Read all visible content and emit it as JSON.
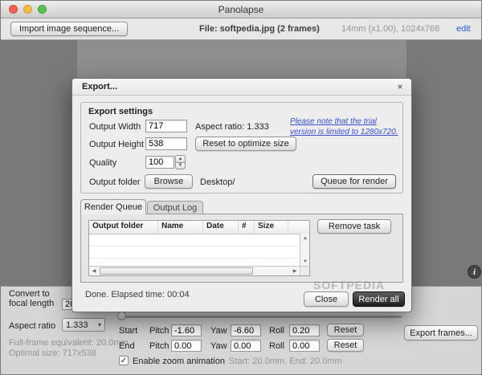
{
  "window": {
    "title": "Panolapse"
  },
  "toolbar": {
    "import_button": "Import image sequence...",
    "file_label": "File: softpedia.jpg (2 frames)",
    "lens_info": "14mm (x1.00), 1024x768",
    "edit_link": "edit"
  },
  "export_dialog": {
    "title": "Export...",
    "settings": {
      "group_title": "Export settings",
      "output_width_label": "Output Width",
      "output_width": "717",
      "aspect_ratio_text": "Aspect ratio: 1.333",
      "trial_note": "Please note that the trial version is limited to 1280x720.",
      "output_height_label": "Output Height",
      "output_height": "538",
      "reset_optimize_button": "Reset to optimize size",
      "quality_label": "Quality",
      "quality": "100",
      "output_folder_label": "Output folder",
      "browse_button": "Browse",
      "output_folder_path": "Desktop/",
      "queue_button": "Queue for render"
    },
    "tabs": [
      {
        "label": "Render Queue",
        "active": true
      },
      {
        "label": "Output Log",
        "active": false
      }
    ],
    "queue_table": {
      "columns": [
        "Output folder",
        "Name",
        "Date",
        "#",
        "Size"
      ],
      "rows": []
    },
    "remove_task_button": "Remove task",
    "status_text": "Done. Elapsed time: 00:04",
    "close_button": "Close",
    "render_all_button": "Render all"
  },
  "bottom_panel": {
    "convert_label": "Convert to focal length",
    "convert_value": "20",
    "aspect_ratio_label": "Aspect ratio",
    "aspect_ratio_value": "1.333",
    "full_frame_text": "Full-frame equivalent: 20.0mm",
    "optimal_size_text": "Optimal size: 717x538",
    "start_label": "Start",
    "end_label": "End",
    "pitch_label": "Pitch",
    "yaw_label": "Yaw",
    "roll_label": "Roll",
    "start": {
      "pitch": "-1.60",
      "yaw": "-6.60",
      "roll": "0.20"
    },
    "end": {
      "pitch": "0.00",
      "yaw": "0.00",
      "roll": "0.00"
    },
    "reset_button": "Reset",
    "zoom_checkbox_label": "Enable zoom animation",
    "zoom_checkbox_checked": true,
    "zoom_range_text": "Start: 20.0mm, End: 20.0mm",
    "export_frames_button": "Export frames..."
  },
  "watermark": "SOFTPEDIA",
  "colors": {
    "link_blue": "#2a5bd7",
    "trial_note_blue": "#3c4ed8",
    "render_all_dark": "#1e1e1e",
    "canvas_gray": "#8d8d8d"
  },
  "icons": {
    "close": "×",
    "dropdown": "▾",
    "spin_up": "▲",
    "spin_down": "▼",
    "left": "◀",
    "right": "▶",
    "up": "▲",
    "down": "▼",
    "info": "i",
    "check": "✓"
  }
}
